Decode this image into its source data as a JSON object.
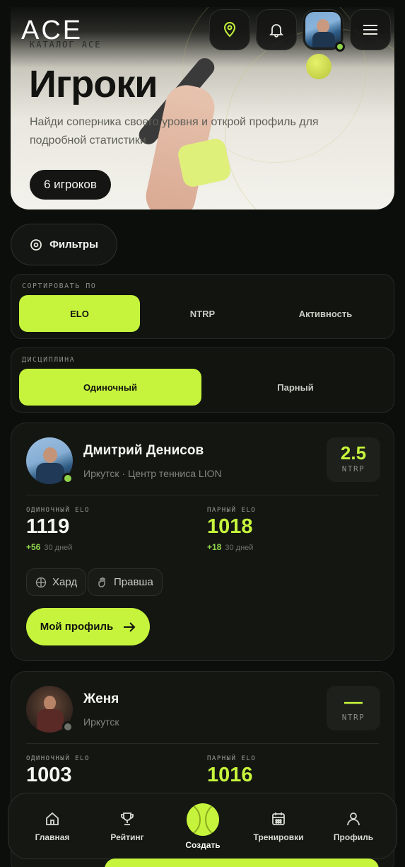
{
  "header": {
    "logo": "ACE",
    "icons": [
      "location-pin-icon",
      "bell-icon",
      "user-avatar",
      "menu-icon"
    ]
  },
  "hero": {
    "kicker": "КАТАЛОГ ACE",
    "title": "Игроки",
    "subtitle": "Найди соперника своего уровня и открой профиль для подробной статистики",
    "count": "6 игроков"
  },
  "filters": {
    "label": "Фильтры"
  },
  "sort": {
    "label": "СОРТИРОВАТЬ ПО",
    "options": [
      "ELO",
      "NTRP",
      "Активность"
    ],
    "active": "ELO"
  },
  "discipline": {
    "label": "ДИСЦИПЛИНА",
    "options": [
      "Одиночный",
      "Парный"
    ],
    "active": "Одиночный"
  },
  "players": [
    {
      "name": "Дмитрий Денисов",
      "location": "Иркутск · Центр тенниса LION",
      "ntrp": "2.5",
      "ntrp_label": "NTRP",
      "online": true,
      "singles_label": "ОДИНОЧНЫЙ ELO",
      "singles_elo": "1119",
      "singles_delta": "+56",
      "singles_period": "30 дней",
      "doubles_label": "ПАРНЫЙ ELO",
      "doubles_elo": "1018",
      "doubles_delta": "+18",
      "doubles_period": "30 дней",
      "tags": [
        "Хард",
        "Правша"
      ],
      "action": "Мой профиль"
    },
    {
      "name": "Женя",
      "location": "Иркутск",
      "ntrp": "—",
      "ntrp_label": "NTRP",
      "online": false,
      "singles_label": "ОДИНОЧНЫЙ ELO",
      "singles_elo": "1003",
      "doubles_label": "ПАРНЫЙ ELO",
      "doubles_elo": "1016"
    }
  ],
  "nav": {
    "items": [
      "Главная",
      "Рейтинг",
      "Создать",
      "Тренировки",
      "Профиль"
    ]
  },
  "colors": {
    "accent": "#c6f43c",
    "background": "#0c0e0b",
    "online": "#8fd44a"
  }
}
